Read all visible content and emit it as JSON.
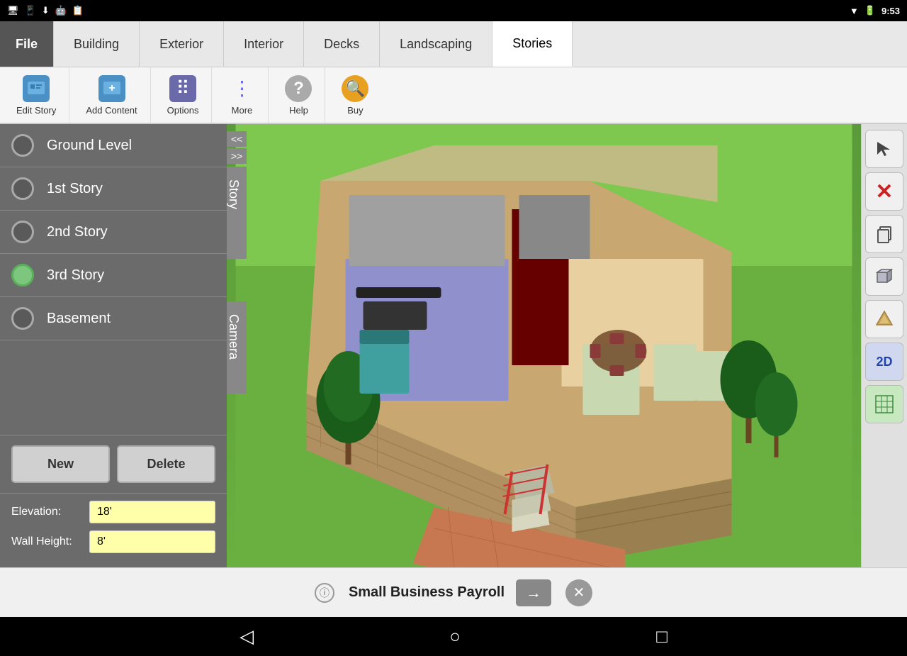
{
  "statusBar": {
    "time": "9:53",
    "icons": [
      "battery",
      "wifi",
      "signal"
    ]
  },
  "tabs": {
    "items": [
      {
        "label": "File",
        "id": "file"
      },
      {
        "label": "Building",
        "id": "building"
      },
      {
        "label": "Exterior",
        "id": "exterior"
      },
      {
        "label": "Interior",
        "id": "interior"
      },
      {
        "label": "Decks",
        "id": "decks"
      },
      {
        "label": "Landscaping",
        "id": "landscaping"
      },
      {
        "label": "Stories",
        "id": "stories"
      }
    ],
    "active": "stories"
  },
  "toolbar": {
    "items": [
      {
        "label": "Edit Story",
        "id": "edit-story"
      },
      {
        "label": "Add Content",
        "id": "add-content"
      },
      {
        "label": "Options",
        "id": "options"
      },
      {
        "label": "More",
        "id": "more"
      },
      {
        "label": "Help",
        "id": "help"
      },
      {
        "label": "Buy",
        "id": "buy"
      }
    ]
  },
  "stories": {
    "items": [
      {
        "label": "Ground Level",
        "active": false
      },
      {
        "label": "1st Story",
        "active": false
      },
      {
        "label": "2nd Story",
        "active": false
      },
      {
        "label": "3rd Story",
        "active": true
      },
      {
        "label": "Basement",
        "active": false
      }
    ],
    "buttons": {
      "new": "New",
      "delete": "Delete"
    },
    "fields": {
      "elevation": {
        "label": "Elevation:",
        "value": "18'"
      },
      "wallHeight": {
        "label": "Wall Height:",
        "value": "8'"
      }
    }
  },
  "sideTabs": {
    "story": "Story",
    "camera": "Camera"
  },
  "rightToolbar": {
    "items": [
      {
        "label": "cursor",
        "symbol": "↗",
        "type": "cursor"
      },
      {
        "label": "delete",
        "symbol": "✕",
        "type": "red"
      },
      {
        "label": "copy",
        "symbol": "⧉",
        "type": "normal"
      },
      {
        "label": "3d-box",
        "symbol": "▣",
        "type": "normal"
      },
      {
        "label": "material",
        "symbol": "◆",
        "type": "normal"
      },
      {
        "label": "2d",
        "symbol": "2D",
        "type": "blue-text"
      },
      {
        "label": "grid",
        "symbol": "⊞",
        "type": "green-grid"
      }
    ]
  },
  "adBanner": {
    "text": "Small Business Payroll",
    "arrowSymbol": "→",
    "closeSymbol": "✕"
  },
  "bottomNav": {
    "back": "◁",
    "home": "○",
    "recent": "□"
  },
  "collapseArrows": {
    "up": "<<",
    "down": ">>"
  }
}
